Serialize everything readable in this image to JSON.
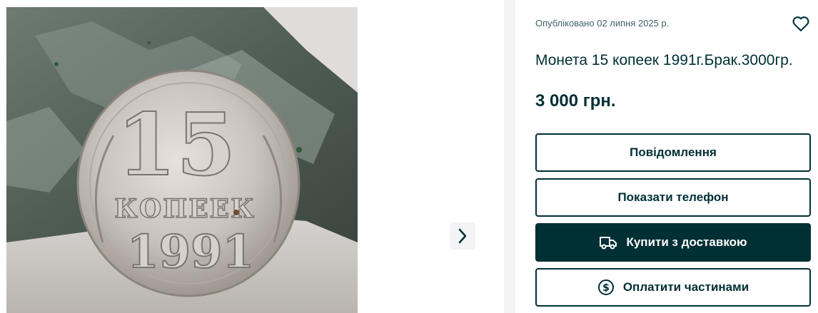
{
  "gallery": {
    "photo_alt": "",
    "next_icon": "chevron-right-icon"
  },
  "listing": {
    "published": "Опубліковано 02 липня 2025 р.",
    "title": "Монета 15 копеек 1991г.Брак.3000гр.",
    "price": "3 000 грн."
  },
  "actions": {
    "message": "Повідомлення",
    "show_phone": "Показати телефон",
    "buy_delivery": "Купити з доставкою",
    "pay_installments": "Оплатити частинами"
  },
  "icons": {
    "favorite": "heart-icon",
    "delivery": "truck-icon",
    "installments": "dollar-circle-icon"
  },
  "colors": {
    "brand_dark": "#002f34",
    "panel_bg": "#f2f4f5",
    "muted_text": "#406367"
  }
}
